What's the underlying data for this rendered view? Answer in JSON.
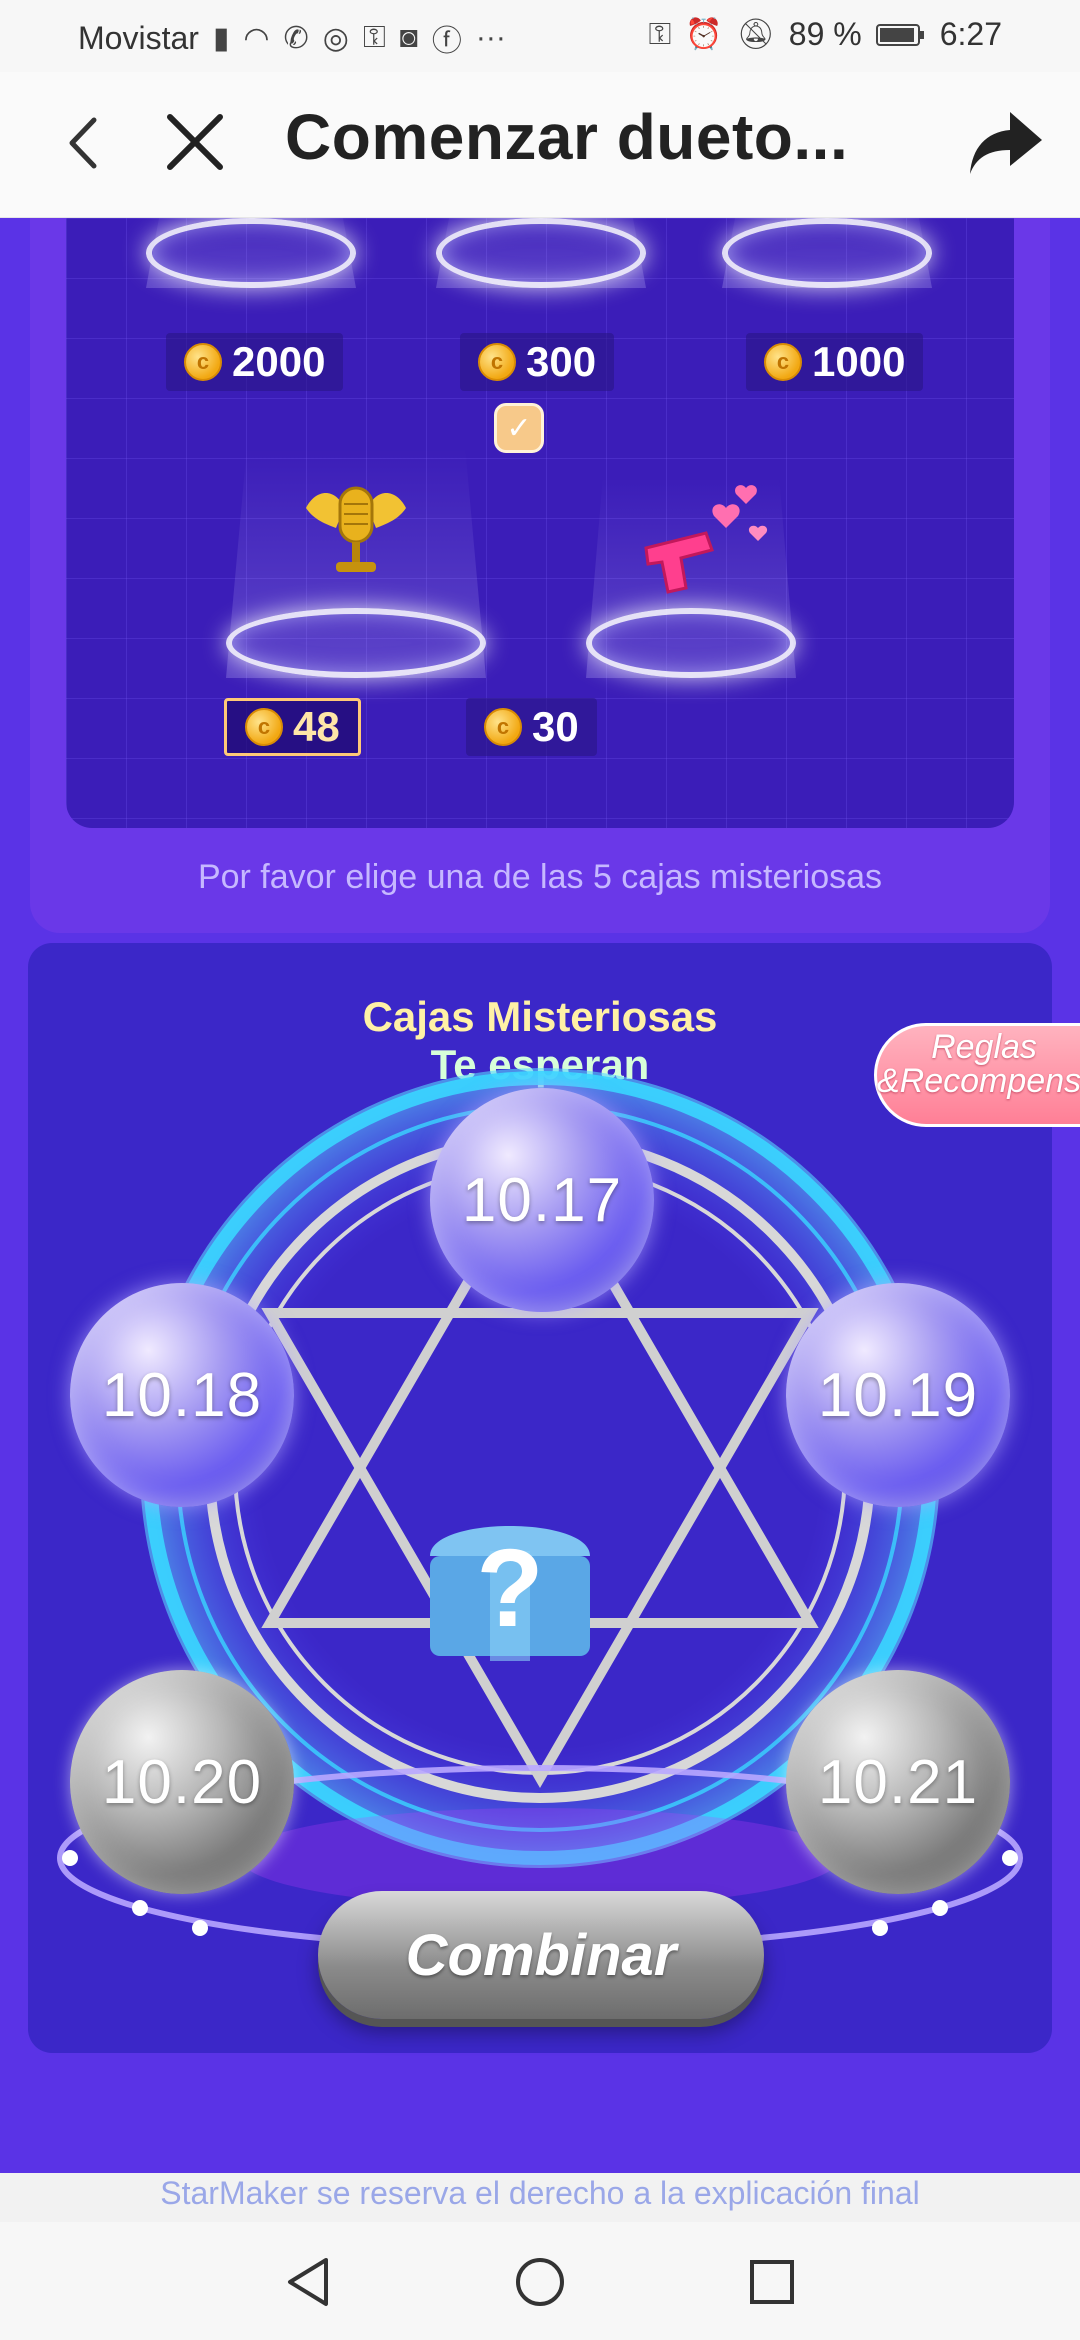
{
  "status_bar": {
    "carrier": "Movistar",
    "battery": "89 %",
    "time": "6:27"
  },
  "app_bar": {
    "title": "Comenzar dueto...",
    "back_icon": "back-chevron-icon",
    "close_icon": "close-icon",
    "share_icon": "share-icon"
  },
  "gift_picker": {
    "items": [
      {
        "price": "2000",
        "selected": false
      },
      {
        "price": "300",
        "selected": false
      },
      {
        "price": "1000",
        "selected": false
      },
      {
        "price": "48",
        "selected": true,
        "icon": "golden-microphone-icon"
      },
      {
        "price": "30",
        "selected": false,
        "icon": "heart-gun-icon"
      }
    ],
    "hint": "Por favor elige una de las 5 cajas misteriosas"
  },
  "mystery": {
    "title_line1": "Cajas Misteriosas",
    "title_line2": "Te esperan",
    "rules_button": "Reglas &Recompensas",
    "center_box_icon": "mystery-chest-icon",
    "center_box_glyph": "?",
    "bubbles": [
      {
        "label": "10.17",
        "state": "active"
      },
      {
        "label": "10.18",
        "state": "active"
      },
      {
        "label": "10.19",
        "state": "active"
      },
      {
        "label": "10.20",
        "state": "inactive"
      },
      {
        "label": "10.21",
        "state": "inactive"
      }
    ],
    "combine_button": "Combinar"
  },
  "footer_note": "StarMaker se reserva el derecho a la explicación final",
  "colors": {
    "primary_purple": "#5a33e6",
    "panel_purple": "#3b27c8",
    "selected_gold": "#ffc977",
    "rules_pink": "#ff7f96"
  }
}
